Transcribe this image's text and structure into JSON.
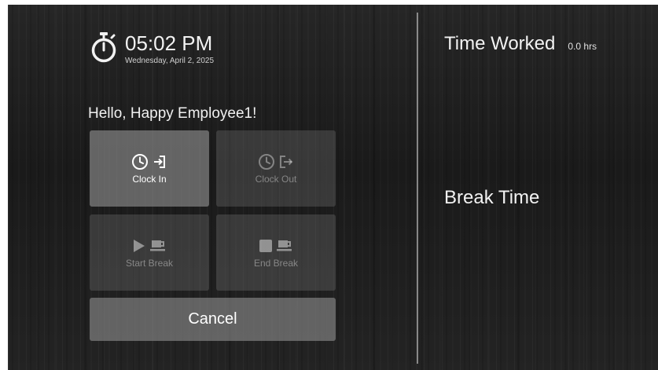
{
  "header": {
    "time": "05:02 PM",
    "date": "Wednesday, April 2, 2025",
    "icon": "stopwatch-icon"
  },
  "greeting": "Hello, Happy Employee1!",
  "actions": {
    "clock_in": {
      "label": "Clock In",
      "enabled": true,
      "icons": [
        "clock-icon",
        "login-arrow-icon"
      ]
    },
    "clock_out": {
      "label": "Clock Out",
      "enabled": false,
      "icons": [
        "clock-icon",
        "logout-arrow-icon"
      ]
    },
    "start_break": {
      "label": "Start Break",
      "enabled": false,
      "icons": [
        "play-icon",
        "coffee-cup-icon"
      ]
    },
    "end_break": {
      "label": "End Break",
      "enabled": false,
      "icons": [
        "stop-icon",
        "coffee-cup-icon"
      ]
    }
  },
  "cancel_label": "Cancel",
  "summary": {
    "time_worked_label": "Time Worked",
    "time_worked_value": "0.0 hrs",
    "break_time_label": "Break Time"
  },
  "colors": {
    "background": "#1c1c1c",
    "text": "#f2f2f2",
    "tile_active": "#969696",
    "divider": "#dcdcdc"
  }
}
